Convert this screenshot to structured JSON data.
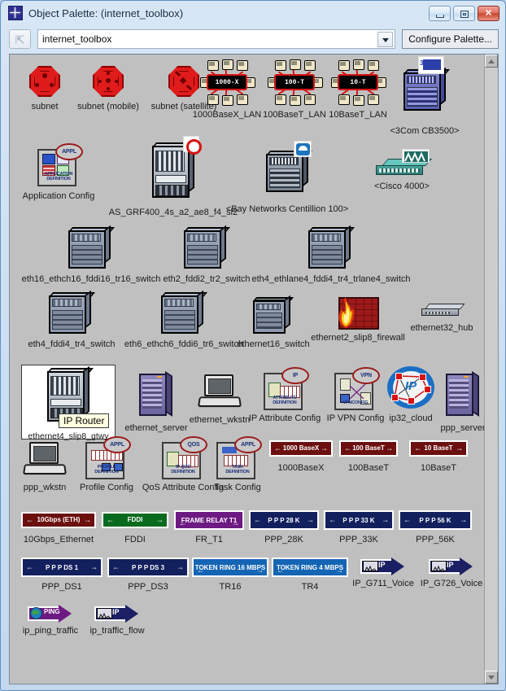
{
  "window": {
    "title": "Object Palette: (internet_toolbox)",
    "app_icon": "sparkle-icon",
    "buttons": {
      "minimize": "minimize-icon",
      "maximize": "maximize-icon",
      "close": "✕"
    }
  },
  "toolbar": {
    "up_button_icon": "up-arrow-icon",
    "palette_value": "internet_toolbox",
    "palette_placeholder": "internet_toolbox",
    "dropdown_icon": "chevron-down-icon",
    "configure_label": "Configure Palette..."
  },
  "scrollbar": {
    "up_icon": "scroll-up-icon",
    "down_icon": "scroll-down-icon"
  },
  "tooltip": {
    "text": "IP Router"
  },
  "palette": {
    "rows": [
      {
        "row": 1,
        "items": [
          {
            "label": "subnet",
            "icon": "subnet-octagon-icon",
            "type": "octagon"
          },
          {
            "label": "subnet (mobile)",
            "icon": "subnet-mobile-octagon-icon",
            "type": "octagon"
          },
          {
            "label": "subnet (satellite)",
            "icon": "subnet-satellite-octagon-icon",
            "type": "octagon"
          },
          {
            "label": "1000BaseX_LAN",
            "icon": "lan-cluster-icon",
            "type": "lan",
            "hub_text": "1000-X"
          },
          {
            "label": "100BaseT_LAN",
            "icon": "lan-cluster-icon",
            "type": "lan",
            "hub_text": "100-T"
          },
          {
            "label": "10BaseT_LAN",
            "icon": "lan-cluster-icon",
            "type": "lan",
            "hub_text": "10-T"
          },
          {
            "label": "<3Com CB3500>",
            "icon": "3com-chassis-icon",
            "type": "chassis",
            "tag": "3Com"
          }
        ]
      },
      {
        "row": 2,
        "items": [
          {
            "label": "Application Config",
            "icon": "application-definition-icon",
            "type": "cfgdoc",
            "badge": "APPL",
            "caption": "APPLICATION DEFINITION"
          },
          {
            "label": "AS_GRF400_4s_a2_ae8_f4_sl2",
            "icon": "ascend-chassis-icon",
            "type": "chassis",
            "tag": "ascend-logo"
          },
          {
            "label": "<Bay Networks Centillion 100>",
            "icon": "bay-networks-chassis-icon",
            "type": "chassis",
            "tag": "bay-logo"
          },
          {
            "label": "<Cisco 4000>",
            "icon": "cisco-router-icon",
            "type": "ciscorouter",
            "tag": "cisco-logo"
          }
        ]
      },
      {
        "row": 3,
        "items": [
          {
            "label": "eth16_ethch16_fddi16_tr16_switch",
            "icon": "switch-chassis-icon",
            "type": "chassis"
          },
          {
            "label": "eth2_fddi2_tr2_switch",
            "icon": "switch-chassis-icon",
            "type": "chassis"
          },
          {
            "label": "eth4_ethlane4_fddi4_tr4_trlane4_switch",
            "icon": "switch-chassis-icon",
            "type": "chassis"
          }
        ]
      },
      {
        "row": 4,
        "items": [
          {
            "label": "eth4_fddi4_tr4_switch",
            "icon": "switch-chassis-icon",
            "type": "chassis"
          },
          {
            "label": "eth6_ethch6_fddi6_tr6_switch",
            "icon": "switch-chassis-icon",
            "type": "chassis"
          },
          {
            "label": "ethernet16_switch",
            "icon": "switch-chassis-icon",
            "type": "chassis"
          },
          {
            "label": "ethernet2_slip8_firewall",
            "icon": "firewall-icon",
            "type": "firewall"
          },
          {
            "label": "ethernet32_hub",
            "icon": "hub-icon",
            "type": "hubflat"
          }
        ]
      },
      {
        "row": 5,
        "items": [
          {
            "label": "ethernet4_slip8_gtwy",
            "icon": "router-chassis-icon",
            "type": "chassis",
            "selected": true
          },
          {
            "label": "ethernet_server",
            "icon": "server-tower-icon",
            "type": "tower"
          },
          {
            "label": "ethernet_wkstn",
            "icon": "workstation-icon",
            "type": "wkstn"
          },
          {
            "label": "IP Attribute Config",
            "icon": "ip-attribute-definition-icon",
            "type": "cfgdoc",
            "badge": "IP",
            "caption": "ATTRIBUTE DEFINITION"
          },
          {
            "label": "IP VPN Config",
            "icon": "ip-vpnconfig-icon",
            "type": "cfgdoc",
            "badge": "VPN",
            "caption": "VPNCONFIG"
          },
          {
            "label": "ip32_cloud",
            "icon": "ip-cloud-icon",
            "type": "cloud"
          },
          {
            "label": "ppp_server",
            "icon": "server-tower-icon",
            "type": "tower"
          }
        ]
      },
      {
        "row": 6,
        "items": [
          {
            "label": "ppp_wkstn",
            "icon": "workstation-icon",
            "type": "wkstn"
          },
          {
            "label": "Profile Config",
            "icon": "profile-definition-icon",
            "type": "cfgdoc",
            "badge": "APPL",
            "caption": "PROFILE DEFINITION"
          },
          {
            "label": "QoS Attribute Config",
            "icon": "ip-qos-definition-icon",
            "type": "cfgdoc",
            "badge": "QOS",
            "caption": "IP QOS DEFINITION"
          },
          {
            "label": "Task Config",
            "icon": "task-definition-icon",
            "type": "cfgdoc",
            "badge": "APPL",
            "caption": "TASK DEFINITION"
          },
          {
            "label": "1000BaseX",
            "icon": "link-bar-icon",
            "type": "linkbar",
            "bar_text": "1000 BaseX",
            "bar_color": "#6b0f0f"
          },
          {
            "label": "100BaseT",
            "icon": "link-bar-icon",
            "type": "linkbar",
            "bar_text": "100 BaseT",
            "bar_color": "#6b0f0f"
          },
          {
            "label": "10BaseT",
            "icon": "link-bar-icon",
            "type": "linkbar",
            "bar_text": "10 BaseT",
            "bar_color": "#6b0f0f"
          }
        ]
      },
      {
        "row": 7,
        "items": [
          {
            "label": "10Gbps_Ethernet",
            "icon": "link-bar-icon",
            "type": "linkbar",
            "bar_text": "10Gbps (ETH)",
            "bar_color": "#6b0f0f"
          },
          {
            "label": "FDDI",
            "icon": "link-bar-icon",
            "type": "linkbar",
            "bar_text": "FDDI",
            "bar_color": "#0a6b1f"
          },
          {
            "label": "FR_T1",
            "icon": "link-bar-icon",
            "type": "linkbar",
            "bar_text": "FRAME RELAY T1",
            "bar_color": "#6d1a82"
          },
          {
            "label": "PPP_28K",
            "icon": "link-bar-icon",
            "type": "linkbar",
            "bar_text": "P P P 28 K",
            "bar_color": "#13205e"
          },
          {
            "label": "PPP_33K",
            "icon": "link-bar-icon",
            "type": "linkbar",
            "bar_text": "P P P 33 K",
            "bar_color": "#13205e"
          },
          {
            "label": "PPP_56K",
            "icon": "link-bar-icon",
            "type": "linkbar",
            "bar_text": "P P P 56 K",
            "bar_color": "#13205e"
          }
        ]
      },
      {
        "row": 8,
        "items": [
          {
            "label": "PPP_DS1",
            "icon": "link-bar-icon",
            "type": "linkbar",
            "bar_text": "P P P DS 1",
            "bar_color": "#13205e"
          },
          {
            "label": "PPP_DS3",
            "icon": "link-bar-icon",
            "type": "linkbar",
            "bar_text": "P P P DS 3",
            "bar_color": "#13205e"
          },
          {
            "label": "TR16",
            "icon": "link-bar-icon",
            "type": "linkbar",
            "bar_text": "TOKEN RING 16 MBPS",
            "bar_color": "#1565b5"
          },
          {
            "label": "TR4",
            "icon": "link-bar-icon",
            "type": "linkbar",
            "bar_text": "TOKEN RING 4 MBPS",
            "bar_color": "#1565b5"
          },
          {
            "label": "IP_G711_Voice",
            "icon": "ip-traffic-arrow-icon",
            "type": "traffic",
            "arrow_text": "IP"
          },
          {
            "label": "IP_G726_Voice",
            "icon": "ip-traffic-arrow-icon",
            "type": "traffic",
            "arrow_text": "IP"
          }
        ]
      },
      {
        "row": 9,
        "items": [
          {
            "label": "ip_ping_traffic",
            "icon": "ping-traffic-arrow-icon",
            "type": "traffic",
            "arrow_text": "PING"
          },
          {
            "label": "ip_traffic_flow",
            "icon": "ip-traffic-arrow-icon",
            "type": "traffic",
            "arrow_text": "IP"
          }
        ]
      }
    ]
  },
  "colors": {
    "window_frame": "#5f93c4",
    "canvas_bg": "#c0c0c0",
    "subnet_red": "#e01b1b",
    "tooltip_bg": "#ffffe1",
    "link_red": "#6b0f0f",
    "link_green": "#0a6b1f",
    "link_purple": "#6d1a82",
    "link_navy": "#13205e",
    "link_blue": "#1565b5"
  }
}
